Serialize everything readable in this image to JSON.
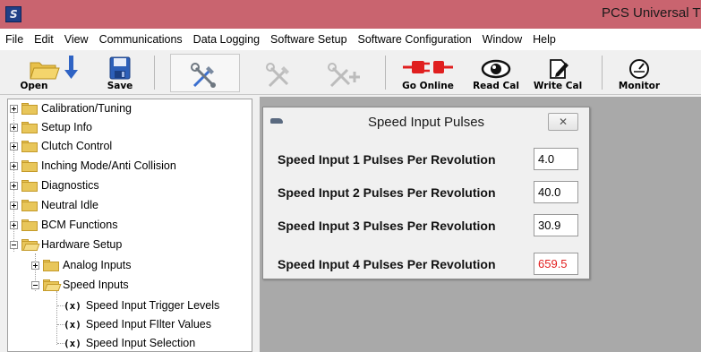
{
  "window": {
    "title": "PCS Universal T"
  },
  "menu": [
    "File",
    "Edit",
    "View",
    "Communications",
    "Data Logging",
    "Software Setup",
    "Software Configuration",
    "Window",
    "Help"
  ],
  "toolbar": {
    "open_label": "Open",
    "save_label": "Save",
    "go_online_label": "Go Online",
    "read_cal_label": "Read Cal",
    "write_cal_label": "Write Cal",
    "monitor_label": "Monitor"
  },
  "tree": {
    "items": [
      {
        "label": "Calibration/Tuning"
      },
      {
        "label": "Setup Info"
      },
      {
        "label": "Clutch Control"
      },
      {
        "label": "Inching Mode/Anti Collision"
      },
      {
        "label": "Diagnostics"
      },
      {
        "label": "Neutral Idle"
      },
      {
        "label": "BCM Functions"
      },
      {
        "label": "Hardware Setup"
      },
      {
        "label": "Analog Inputs"
      },
      {
        "label": "Speed Inputs"
      },
      {
        "label": "Speed Input Trigger Levels"
      },
      {
        "label": "Speed Input FIlter Values"
      },
      {
        "label": "Speed Input Selection"
      }
    ],
    "var_icon_text": "(x)"
  },
  "dialog": {
    "title": "Speed Input Pulses",
    "close_symbol": "✕",
    "rows": [
      {
        "label": "Speed Input 1 Pulses Per Revolution",
        "value": "4.0"
      },
      {
        "label": "Speed Input 2 Pulses Per Revolution",
        "value": "40.0"
      },
      {
        "label": "Speed Input 3 Pulses Per Revolution",
        "value": "30.9"
      },
      {
        "label": "Speed Input 4 Pulses Per Revolution",
        "value": "659.5"
      }
    ]
  },
  "colors": {
    "titlebar": "#c9646f",
    "workspace": "#a9a9a9",
    "warning_value": "#e21d1d"
  }
}
